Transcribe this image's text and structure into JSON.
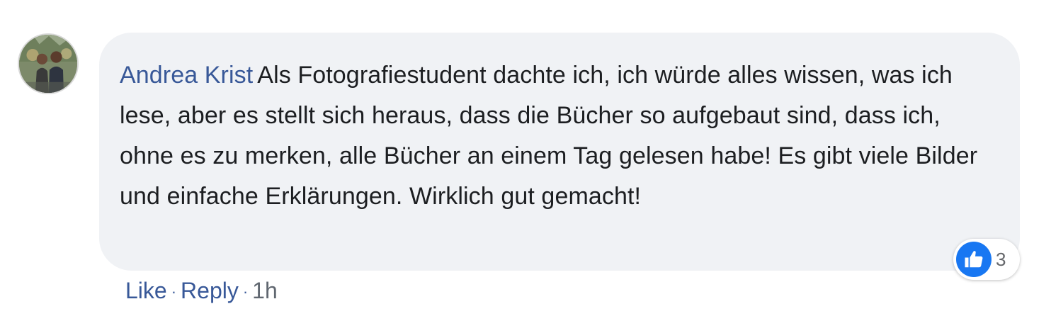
{
  "comment": {
    "author": "Andrea Krist",
    "text": "Als Fotografiestudent dachte ich, ich würde alles wissen, was ich lese, aber es stellt sich heraus, dass die Bücher so aufgebaut sind, dass ich, ohne es zu merken, alle Bücher an einem Tag gelesen habe! Es gibt viele Bilder und einfache Erklärungen. Wirklich gut gemacht!",
    "reactions": {
      "icon": "like-icon",
      "count": "3"
    }
  },
  "actions": {
    "like_label": "Like",
    "separator": "·",
    "reply_label": "Reply",
    "timestamp": "1h"
  },
  "colors": {
    "author_link": "#385898",
    "bubble_bg": "#f0f2f5",
    "like_blue": "#1877f2",
    "text": "#1c1e21"
  }
}
